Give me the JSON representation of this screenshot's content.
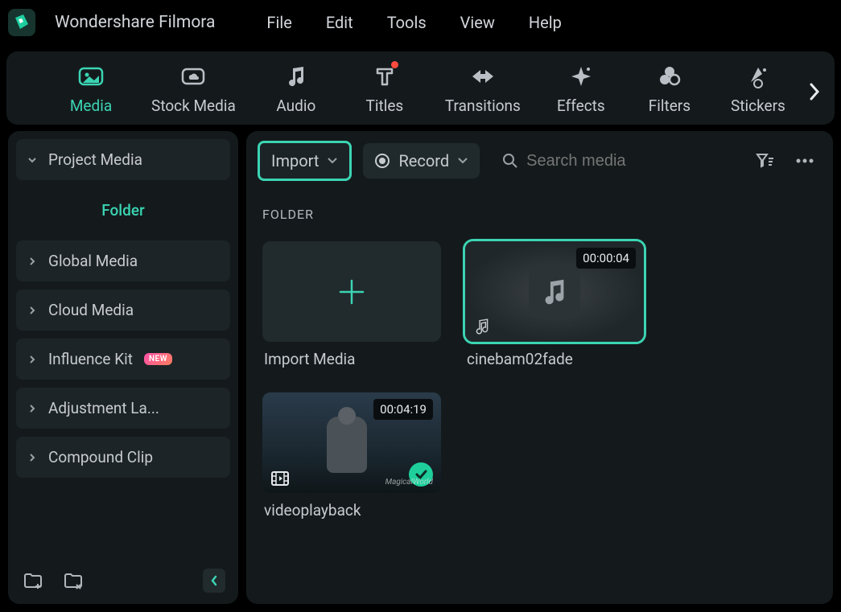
{
  "app_name": "Wondershare Filmora",
  "menu": [
    "File",
    "Edit",
    "Tools",
    "View",
    "Help"
  ],
  "shelf": [
    {
      "label": "Media",
      "icon": "image",
      "active": true
    },
    {
      "label": "Stock Media",
      "icon": "cloud"
    },
    {
      "label": "Audio",
      "icon": "note"
    },
    {
      "label": "Titles",
      "icon": "text",
      "badge": true
    },
    {
      "label": "Transitions",
      "icon": "transition"
    },
    {
      "label": "Effects",
      "icon": "sparkle"
    },
    {
      "label": "Filters",
      "icon": "dots"
    },
    {
      "label": "Stickers",
      "icon": "sticker"
    }
  ],
  "sidebar": {
    "items": [
      {
        "label": "Project Media",
        "expanded": true,
        "active": true
      },
      {
        "label": "Folder",
        "child": true
      },
      {
        "label": "Global Media"
      },
      {
        "label": "Cloud Media"
      },
      {
        "label": "Influence Kit",
        "badge": "NEW"
      },
      {
        "label": "Adjustment La..."
      },
      {
        "label": "Compound Clip"
      }
    ]
  },
  "toolbar": {
    "import_label": "Import",
    "record_label": "Record",
    "search_placeholder": "Search media"
  },
  "section_title": "FOLDER",
  "tiles": [
    {
      "type": "import",
      "label": "Import Media"
    },
    {
      "type": "audio",
      "label": "cinebam02fade",
      "duration": "00:00:04",
      "selected": true
    },
    {
      "type": "video",
      "label": "videoplayback",
      "duration": "00:04:19",
      "checked": true,
      "watermark": "MagicalWorld"
    }
  ]
}
